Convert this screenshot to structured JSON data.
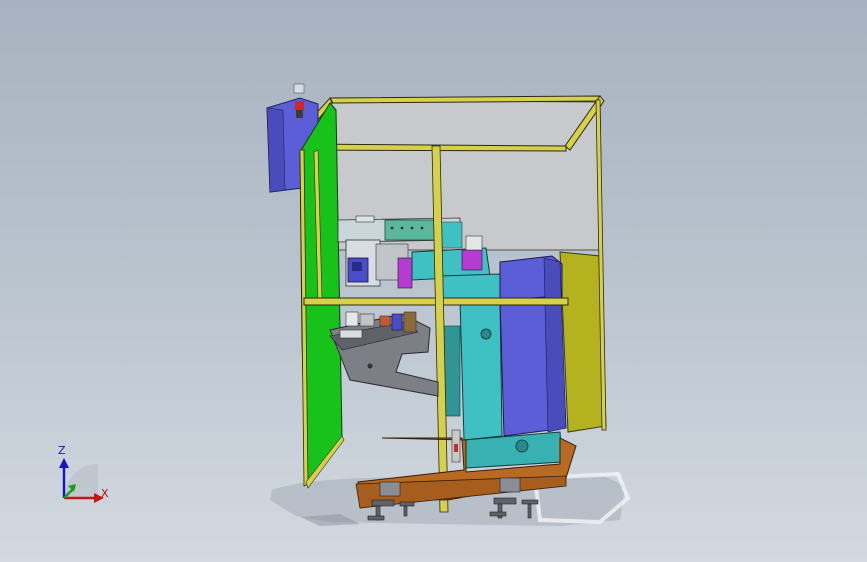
{
  "viewport": {
    "background_top": "#a7b2c0",
    "background_bottom": "#d3d9e0"
  },
  "triad": {
    "x_label": "X",
    "z_label": "Z",
    "x_color": "#c81414",
    "z_color": "#1414c8",
    "y_color": "#14a014"
  },
  "model": {
    "frame_color": "#2b2b10",
    "frame_highlight": "#d6d04a",
    "panel_green": "#17c21b",
    "panel_olive": "#b4b21e",
    "panel_gray": "#c7c9cc",
    "blue_cabinet": "#5c5ed8",
    "cyan_machine": "#3fc0c2",
    "base_orange": "#b86a22",
    "tool_gray": "#7c7f86"
  }
}
